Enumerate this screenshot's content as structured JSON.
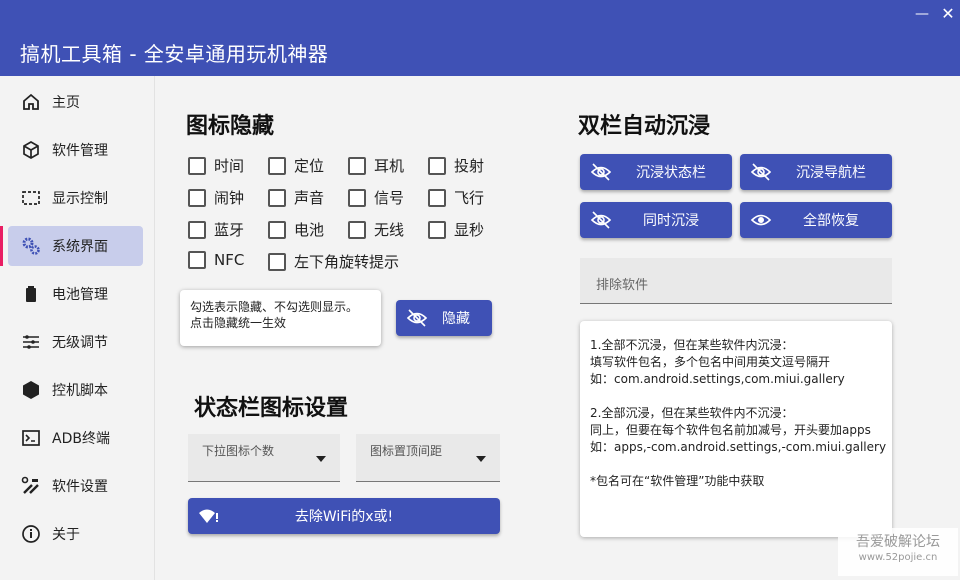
{
  "window": {
    "title": "搞机工具箱 - 全安卓通用玩机神器",
    "minimize": "—",
    "close": "✕"
  },
  "colors": {
    "primary": "#3f51b5",
    "active_bg": "#c8cdeb",
    "active_bar": "#e91e63"
  },
  "sidebar": {
    "items": [
      {
        "label": "主页",
        "icon": "home-icon"
      },
      {
        "label": "软件管理",
        "icon": "cube-icon"
      },
      {
        "label": "显示控制",
        "icon": "screen-frame-icon"
      },
      {
        "label": "系统界面",
        "icon": "gears-icon",
        "active": true
      },
      {
        "label": "电池管理",
        "icon": "battery-icon"
      },
      {
        "label": "无级调节",
        "icon": "sliders-icon"
      },
      {
        "label": "控机脚本",
        "icon": "hexagon-icon"
      },
      {
        "label": "ADB终端",
        "icon": "terminal-icon"
      },
      {
        "label": "软件设置",
        "icon": "tools-icon"
      },
      {
        "label": "关于",
        "icon": "info-icon"
      }
    ]
  },
  "icon_hide": {
    "title": "图标隐藏",
    "checkboxes": [
      "时间",
      "定位",
      "耳机",
      "投射",
      "闹钟",
      "声音",
      "信号",
      "飞行",
      "蓝牙",
      "电池",
      "无线",
      "显秒",
      "NFC",
      "左下角旋转提示"
    ],
    "tip_line1": "勾选表示隐藏、不勾选则显示。",
    "tip_line2": "点击隐藏统一生效",
    "hide_button": "隐藏"
  },
  "statusbar_settings": {
    "title": "状态栏图标设置",
    "dropdown1": "下拉图标个数",
    "dropdown2": "图标置顶间距",
    "wifi_button": "去除WiFi的x或!"
  },
  "immersive": {
    "title": "双栏自动沉浸",
    "buttons": [
      "沉浸状态栏",
      "沉浸导航栏",
      "同时沉浸",
      "全部恢复"
    ],
    "exclude_placeholder": "排除软件",
    "notes": [
      "1.全部不沉浸，但在某些软件内沉浸：",
      "填写软件包名，多个包名中间用英文逗号隔开",
      "如：com.android.settings,com.miui.gallery",
      "",
      "2.全部沉浸，但在某些软件内不沉浸：",
      "同上，但要在每个软件包名前加减号，开头要加apps",
      "如：apps,-com.android.settings,-com.miui.gallery",
      "",
      "*包名可在“软件管理”功能中获取"
    ]
  },
  "watermark": {
    "line1": "吾爱破解论坛",
    "line2": "www.52pojie.cn"
  }
}
